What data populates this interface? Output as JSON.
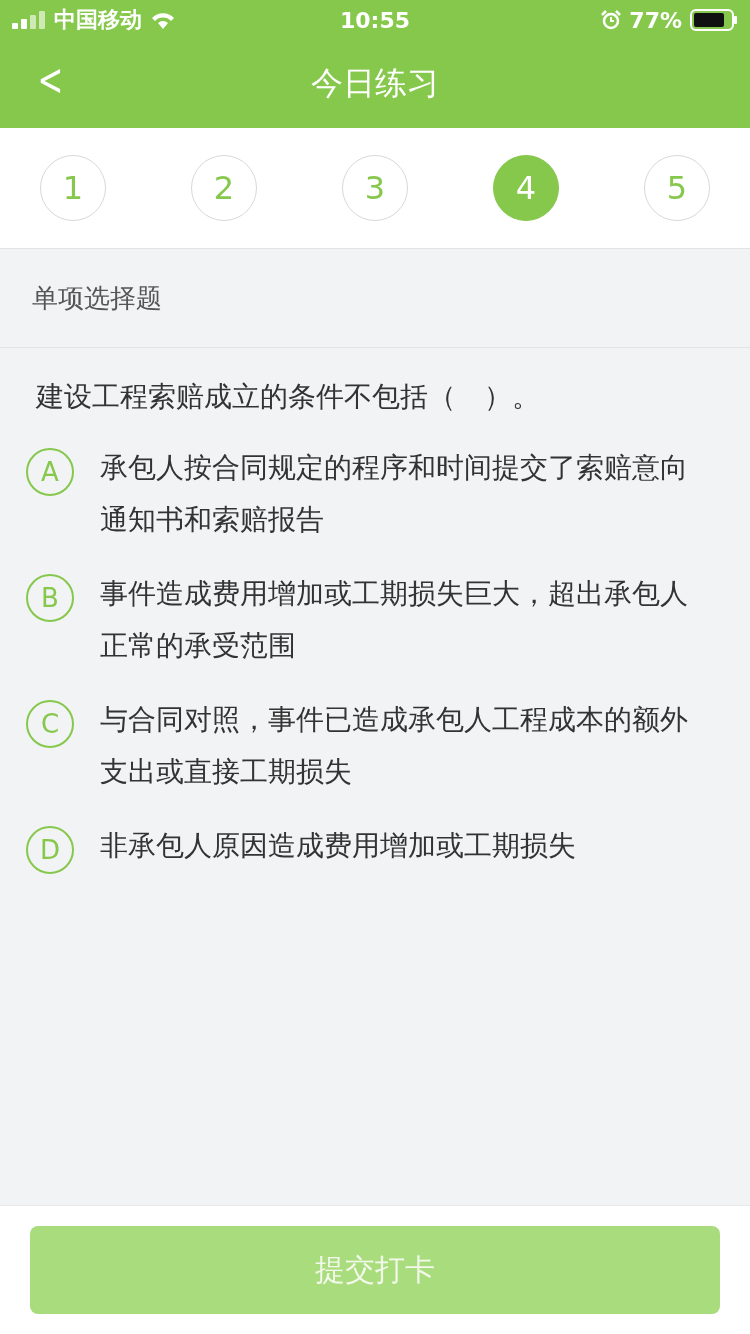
{
  "status_bar": {
    "carrier": "中国移动",
    "time": "10:55",
    "battery": "77%"
  },
  "nav": {
    "back": "<",
    "title": "今日练习"
  },
  "steps": [
    {
      "label": "1",
      "selected": false
    },
    {
      "label": "2",
      "selected": false
    },
    {
      "label": "3",
      "selected": false
    },
    {
      "label": "4",
      "selected": true
    },
    {
      "label": "5",
      "selected": false
    }
  ],
  "section": "单项选择题",
  "question": "建设工程索赔成立的条件不包括（　）。",
  "options": [
    {
      "letter": "A",
      "text": "承包人按合同规定的程序和时间提交了索赔意向通知书和索赔报告",
      "selected": false
    },
    {
      "letter": "B",
      "text": "事件造成费用增加或工期损失巨大，超出承包人正常的承受范围",
      "selected": false
    },
    {
      "letter": "C",
      "text": "与合同对照，事件已造成承包人工程成本的额外支出或直接工期损失",
      "selected": false
    },
    {
      "letter": "D",
      "text": "非承包人原因造成费用增加或工期损失",
      "selected": false
    }
  ],
  "submit": {
    "label": "提交打卡",
    "disabled": true
  }
}
